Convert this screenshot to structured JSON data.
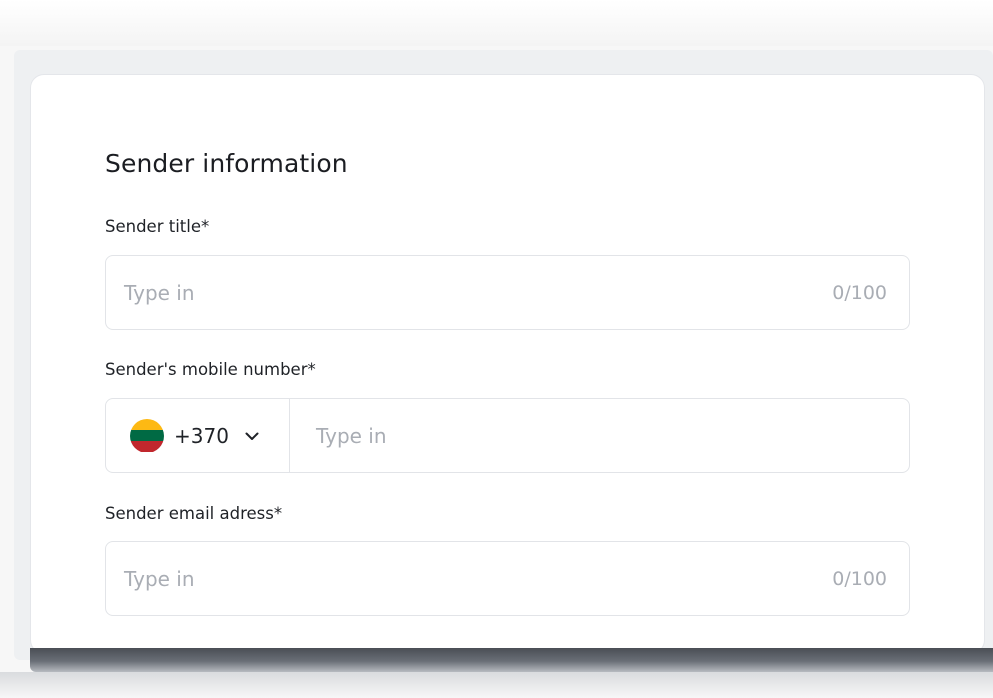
{
  "form": {
    "section_title": "Sender information",
    "title_field": {
      "label": "Sender title*",
      "placeholder": "Type in",
      "counter": "0/100"
    },
    "mobile_field": {
      "label": "Sender's mobile number*",
      "country_flag": "lithuania-flag-icon",
      "dial_code": "+370",
      "placeholder": "Type in"
    },
    "email_field": {
      "label": "Sender email adress*",
      "placeholder": "Type in",
      "counter": "0/100"
    }
  },
  "colors": {
    "flag_yellow": "#FDB913",
    "flag_green": "#006A44",
    "flag_red": "#C1272D",
    "placeholder": "#A9ADB4",
    "border": "#E2E4E8"
  }
}
